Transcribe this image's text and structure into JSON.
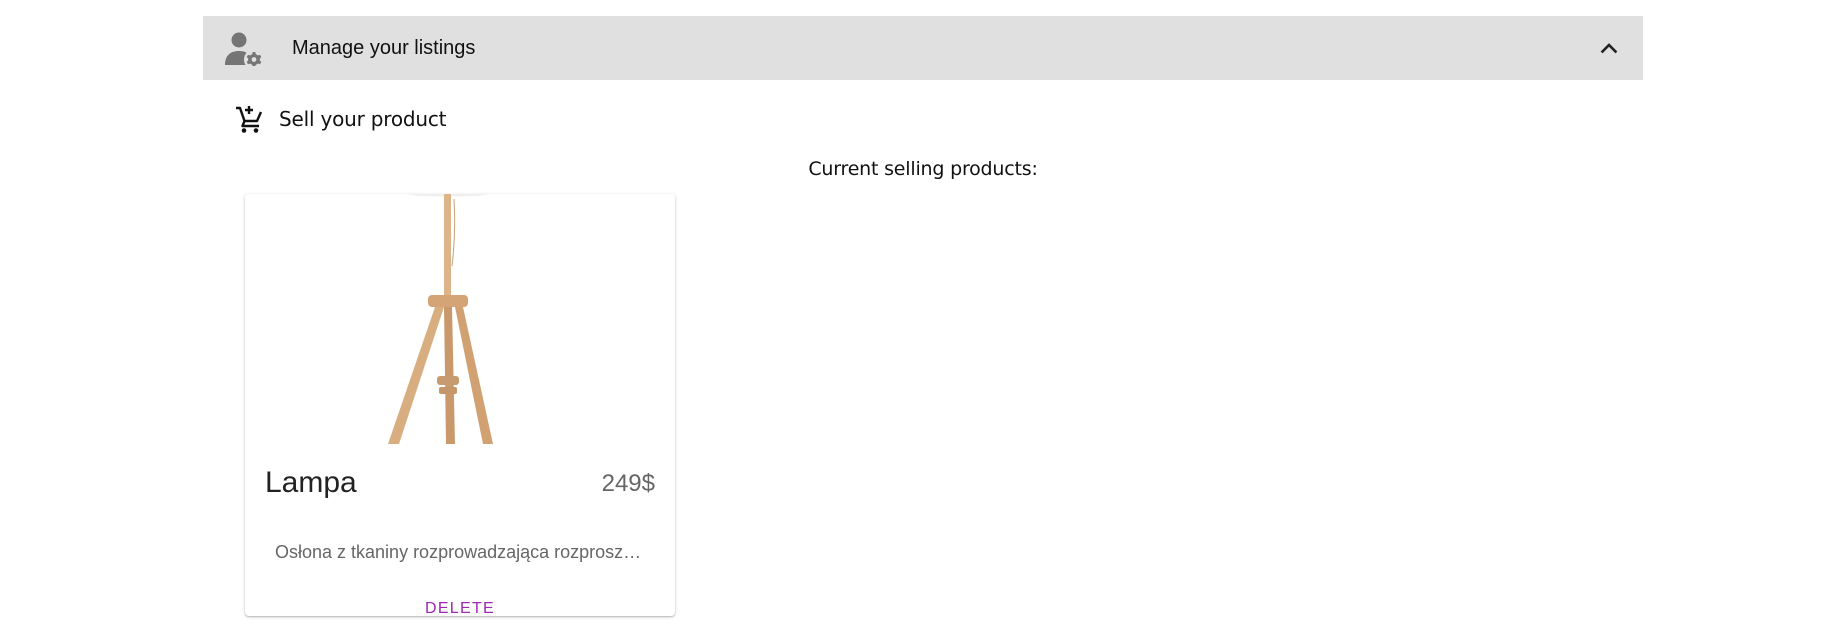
{
  "accordion": {
    "title": "Manage your listings",
    "header_icon": "manage-accounts-icon",
    "toggle_icon": "chevron-up-icon",
    "background": "#e0e0e0"
  },
  "sell": {
    "label": "Sell your product",
    "icon": "add-shopping-cart-icon"
  },
  "listings": {
    "heading": "Current selling products:",
    "products": [
      {
        "name": "Lampa",
        "price": "249$",
        "description": "Osłona z tkaniny rozprowadzająca rozproszone światło",
        "delete_label": "DELETE",
        "accent": "#9c27b0"
      }
    ]
  }
}
